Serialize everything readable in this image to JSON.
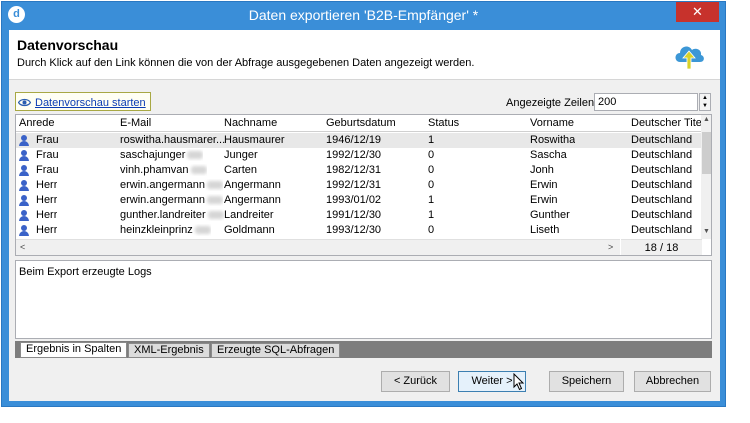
{
  "window": {
    "title": "Daten exportieren 'B2B-Empfänger' *",
    "close_label": "✕",
    "app_icon_label": "d"
  },
  "header": {
    "title": "Datenvorschau",
    "subtitle": "Durch Klick auf den Link können die von der Abfrage ausgegebenen Daten angezeigt werden."
  },
  "toolbar": {
    "preview_link": "Datenvorschau starten",
    "rows_label": "Angezeigte Zeilen:",
    "rows_value": "200"
  },
  "grid": {
    "columns": [
      "Anrede",
      "E-Mail",
      "Nachname",
      "Geburtsdatum",
      "Status",
      "Vorname",
      "Deutscher Titel"
    ],
    "rows": [
      [
        "Frau",
        "roswitha.hausmarer...",
        "Hausmaurer",
        "1946/12/19",
        "1",
        "Roswitha",
        "Deutschland"
      ],
      [
        "Frau",
        "saschajunger",
        "Junger",
        "1992/12/30",
        "0",
        "Sascha",
        "Deutschland"
      ],
      [
        "Frau",
        "vinh.phamvan",
        "Carten",
        "1982/12/31",
        "0",
        "Jonh",
        "Deutschland"
      ],
      [
        "Herr",
        "erwin.angermann",
        "Angermann",
        "1992/12/31",
        "0",
        "Erwin",
        "Deutschland"
      ],
      [
        "Herr",
        "erwin.angermann",
        "Angermann",
        "1993/01/02",
        "1",
        "Erwin",
        "Deutschland"
      ],
      [
        "Herr",
        "gunther.landreiter",
        "Landreiter",
        "1991/12/30",
        "1",
        "Gunther",
        "Deutschland"
      ],
      [
        "Herr",
        "heinzkleinprinz",
        "Goldmann",
        "1993/12/30",
        "0",
        "Liseth",
        "Deutschland"
      ]
    ],
    "counter": "18 / 18"
  },
  "logs": {
    "title": "Beim Export erzeugte Logs"
  },
  "tabs": [
    "Ergebnis in Spalten",
    "XML-Ergebnis",
    "Erzeugte SQL-Abfragen"
  ],
  "buttons": {
    "back": "< Zurück",
    "next": "Weiter >",
    "save": "Speichern",
    "cancel": "Abbrechen"
  }
}
